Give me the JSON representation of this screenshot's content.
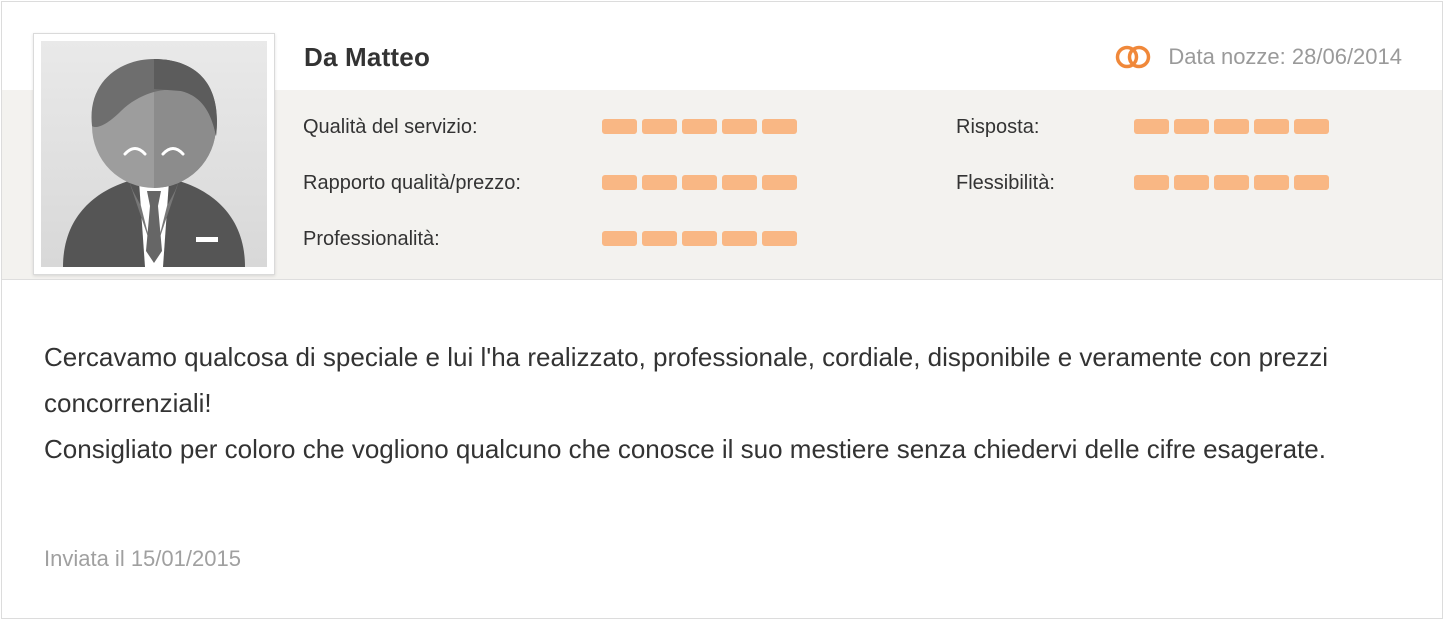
{
  "review": {
    "author": "Da Matteo",
    "wedding_date": "Data nozze: 28/06/2014",
    "icons": {
      "rings": "rings-icon",
      "avatar": "default-male-avatar"
    },
    "accent_color": "#f0883a",
    "rating_color": "#f9b784",
    "ratings": [
      {
        "label": "Qualità del servizio:",
        "value": 5,
        "max": 5
      },
      {
        "label": "Risposta:",
        "value": 5,
        "max": 5
      },
      {
        "label": "Rapporto qualità/prezzo:",
        "value": 5,
        "max": 5
      },
      {
        "label": "Flessibilità:",
        "value": 5,
        "max": 5
      },
      {
        "label": "Professionalità:",
        "value": 5,
        "max": 5
      }
    ],
    "text_lines": [
      "Cercavamo qualcosa di speciale e lui l'ha realizzato, professionale, cordiale, disponibile e veramente con prezzi concorrenziali!",
      "Consigliato per coloro che vogliono qualcuno che conosce il suo mestiere senza chiedervi delle cifre esagerate."
    ],
    "sent_date": "Inviata il 15/01/2015"
  }
}
